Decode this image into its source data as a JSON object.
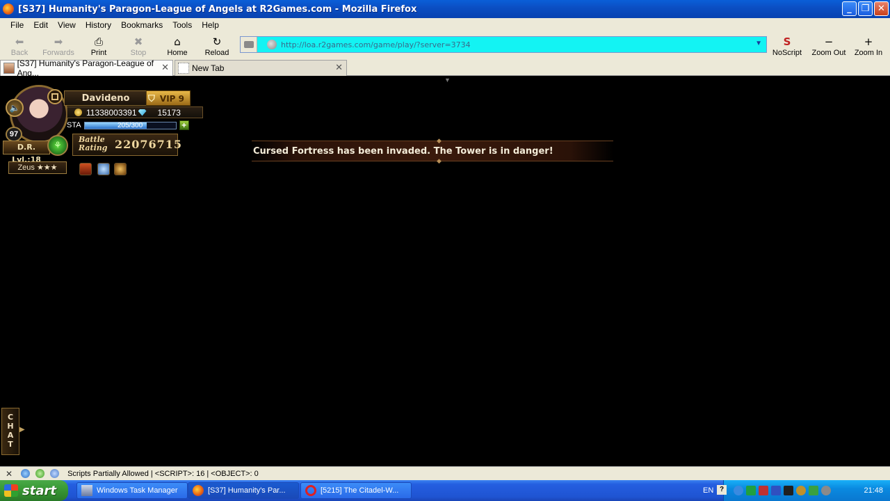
{
  "window": {
    "title": "[S37] Humanity's Paragon-League of Angels at R2Games.com - Mozilla Firefox",
    "minimize": "_",
    "restore": "❐",
    "close": "✕"
  },
  "menu": {
    "items": [
      "File",
      "Edit",
      "View",
      "History",
      "Bookmarks",
      "Tools",
      "Help"
    ]
  },
  "toolbar": {
    "back": "Back",
    "forwards": "Forwards",
    "print": "Print",
    "stop": "Stop",
    "home": "Home",
    "reload": "Reload",
    "noscript": "NoScript",
    "zoom_out": "Zoom Out",
    "zoom_in": "Zoom In",
    "url": "http://loa.r2games.com/game/play/?server=3734"
  },
  "tabs": [
    {
      "label": "[S37] Humanity's Paragon-League of Ang...",
      "active": true
    },
    {
      "label": "New Tab",
      "active": false
    }
  ],
  "hud": {
    "player_name": "Davideno",
    "vip": "VIP 9",
    "level": "97",
    "gold": "11338003391",
    "diamonds": "15173",
    "sta_label": "STA",
    "sta_text": "205/300",
    "sta_fraction": 0.683,
    "sta_plus": "+",
    "dr_level": "D.R. Lvl.:18",
    "battle_label_line1": "Battle",
    "battle_label_line2": "Rating",
    "battle_rating": "22076715",
    "god": "Zeus ★★★"
  },
  "announcement": {
    "text": "Cursed Fortress has been invaded. The Tower is in danger!"
  },
  "chat": {
    "label": "CHAT"
  },
  "statusbar": {
    "text": "Scripts Partially Allowed | <SCRIPT>: 16 | <OBJECT>: 0"
  },
  "taskbar": {
    "start": "start",
    "tasks": [
      "Windows Task Manager",
      "[S37] Humanity's Par...",
      "[5215] The Citadel-W..."
    ],
    "language": "EN",
    "clock": "21:48"
  },
  "colors": {
    "url_bar_bg": "#13f3f3",
    "titlebar": "#0b4fc4",
    "start_green": "#3a9a36"
  }
}
